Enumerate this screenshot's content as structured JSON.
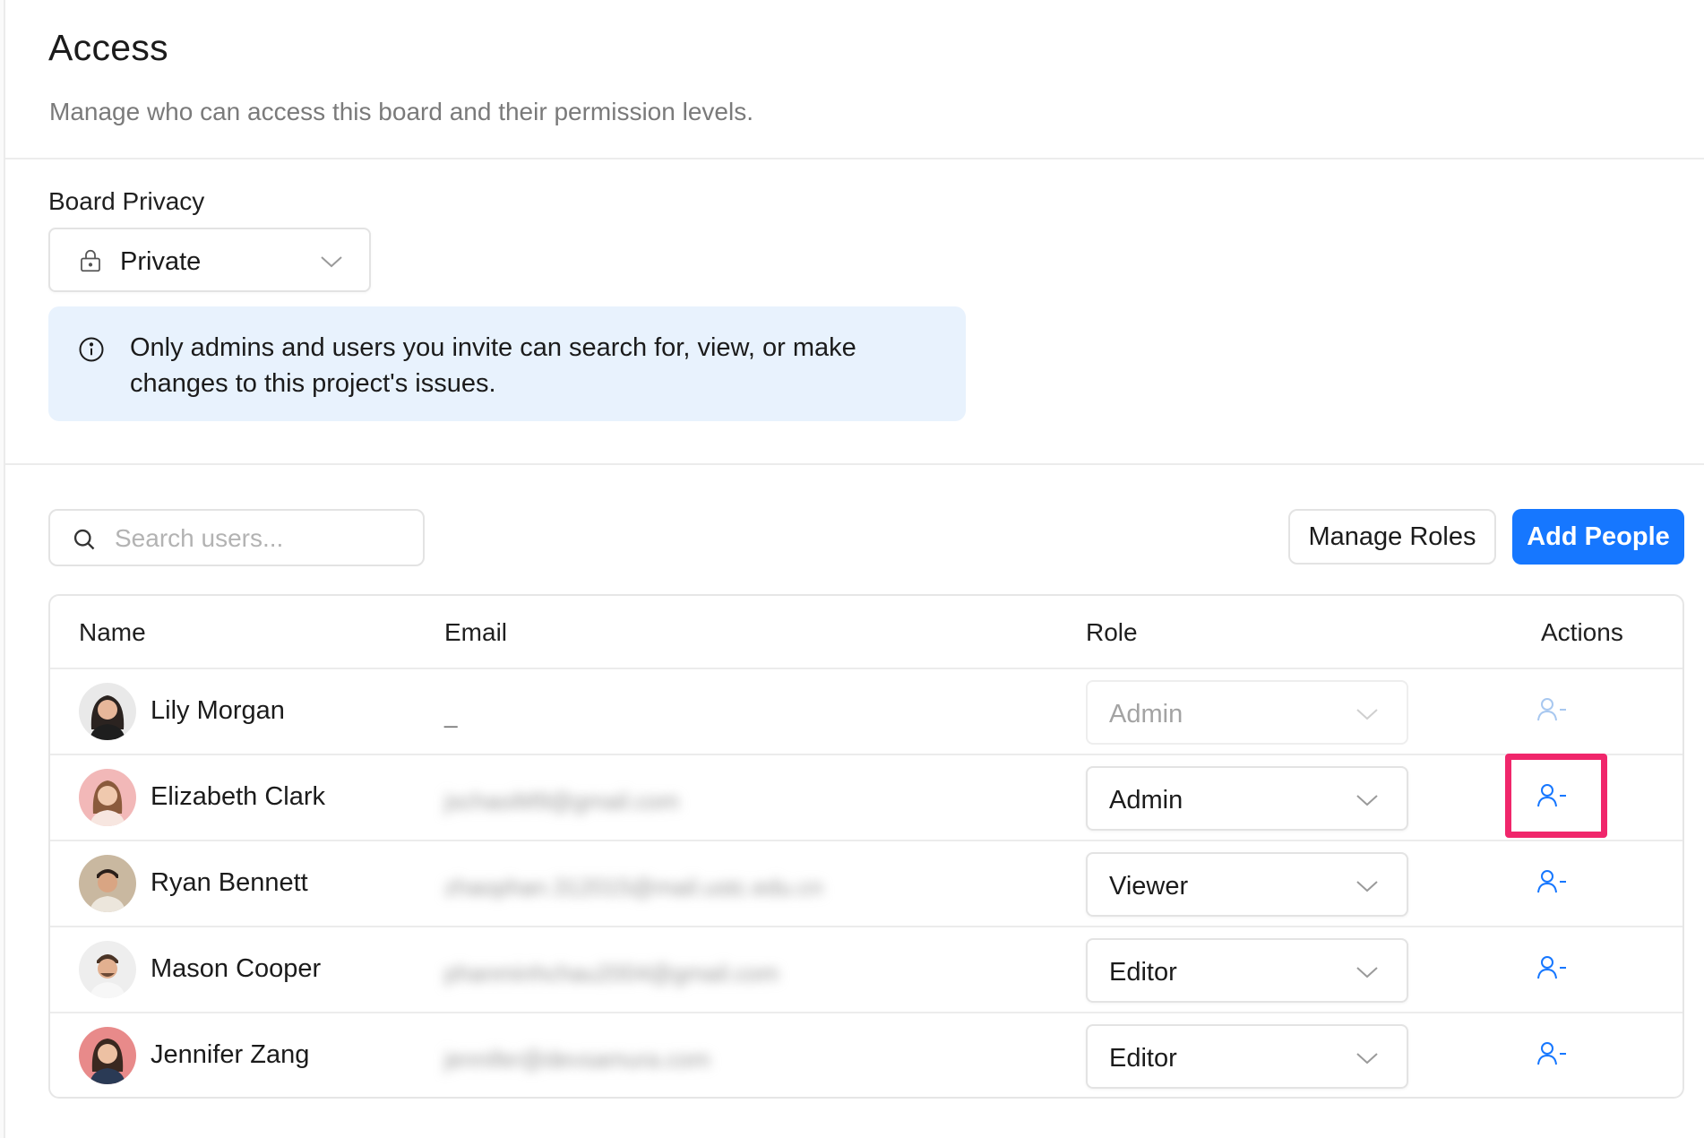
{
  "header": {
    "title": "Access",
    "subtitle": "Manage who can access this board and their permission levels."
  },
  "privacy": {
    "label": "Board Privacy",
    "value": "Private",
    "icon": "lock-icon",
    "info_icon": "info-icon",
    "info_text": "Only admins and users you invite can search for, view, or make changes to this project's issues."
  },
  "toolbar": {
    "search_placeholder": "Search users...",
    "search_icon": "search-icon",
    "manage_roles_label": "Manage Roles",
    "add_people_label": "Add People"
  },
  "table": {
    "columns": [
      "Name",
      "Email",
      "Role",
      "Actions"
    ],
    "rows": [
      {
        "name": "Lily Morgan",
        "email": "_",
        "email_blurred": false,
        "role": "Admin",
        "role_disabled": true,
        "action_icon": "remove-user-icon"
      },
      {
        "name": "Elizabeth Clark",
        "email": "jschaoiM9@gmail.com",
        "email_blurred": true,
        "role": "Admin",
        "role_disabled": false,
        "action_icon": "remove-user-icon",
        "highlighted": true
      },
      {
        "name": "Ryan Bennett",
        "email": "zhaophan.312015@mail.ustc.edu.cn",
        "email_blurred": true,
        "role": "Viewer",
        "role_disabled": false,
        "action_icon": "remove-user-icon"
      },
      {
        "name": "Mason Cooper",
        "email": "phanminhchau2004@gmail.com",
        "email_blurred": true,
        "role": "Editor",
        "role_disabled": false,
        "action_icon": "remove-user-icon"
      },
      {
        "name": "Jennifer Zang",
        "email": "jennifer@devsamura.com",
        "email_blurred": true,
        "role": "Editor",
        "role_disabled": false,
        "action_icon": "remove-user-icon"
      }
    ]
  },
  "colors": {
    "accent": "#1677ff",
    "info_bg": "#e8f2fd",
    "highlight": "#f0266b"
  }
}
